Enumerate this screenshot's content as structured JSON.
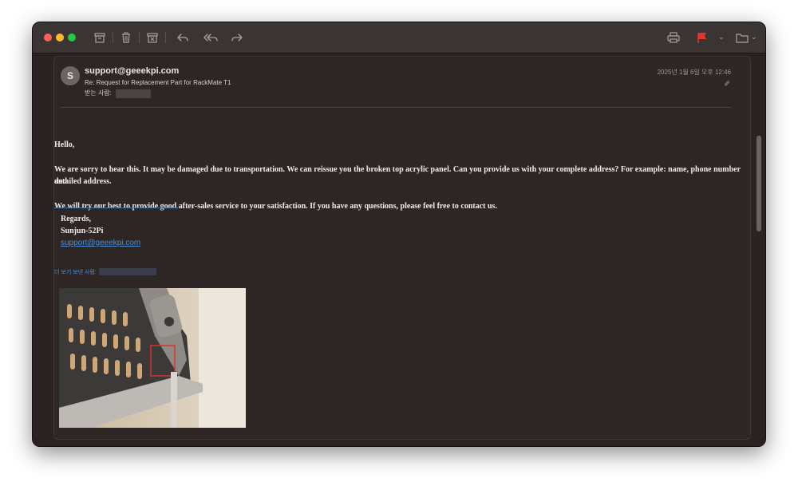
{
  "toolbar": {
    "icons": [
      "archive-icon",
      "trash-icon",
      "junk-icon",
      "reply-icon",
      "reply-all-icon",
      "forward-icon",
      "print-icon",
      "flag-icon",
      "folder-icon"
    ],
    "flag_color": "#e3342f"
  },
  "email": {
    "avatar_initial": "S",
    "sender": "support@geeekpi.com",
    "subject": "Re: Request for Replacement Part for RackMate T1",
    "recipient_label": "받는 사람:",
    "datetime": "2025년 1월 6일 오후 12:46",
    "body": {
      "greeting": "Hello,",
      "paragraph1_line1": "We are sorry to hear this. It may be damaged due to transportation. We can reissue you the broken top acrylic panel. Can you provide us with your complete address? For example: name, phone number and",
      "paragraph1_line2": "detailed address.",
      "paragraph2": "We will try our best to provide good after-sales service to your satisfaction. If you have any questions, please feel free to contact us.",
      "signature_regards": "Regards,",
      "signature_name": "Sunjun-52Pi",
      "signature_email": "support@geeekpi.com"
    },
    "more_recipients_label": "더 보기 보낸 사람:"
  },
  "colors": {
    "link": "#4a90d9",
    "window_bg": "#2b2322"
  }
}
